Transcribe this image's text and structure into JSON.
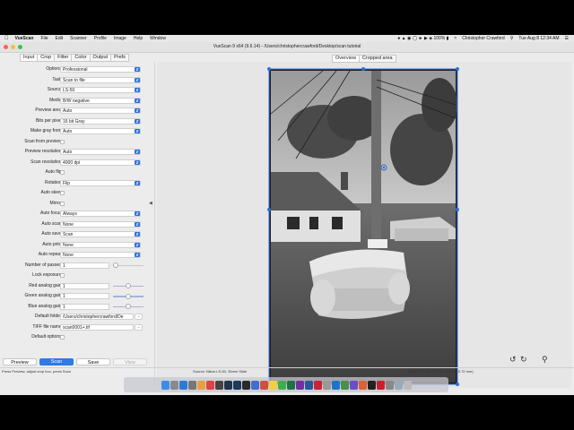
{
  "menubar": {
    "app": "VueScan",
    "items": [
      "File",
      "Edit",
      "Scanner",
      "Profile",
      "Image",
      "Help",
      "Window"
    ],
    "status_user": "Christopher Crawford",
    "clock": "Tue Aug 8  12:34 AM"
  },
  "window": {
    "title": "VueScan 9 x64 (9.6.14) - /Users/christophercrawford/Desktop/scan tutorial"
  },
  "tabs": [
    "Input",
    "Crop",
    "Filter",
    "Color",
    "Output",
    "Prefs"
  ],
  "active_tab": "Input",
  "view_tabs": [
    "Overview",
    "Cropped area"
  ],
  "form": {
    "options": {
      "label": "Options:",
      "value": "Professional"
    },
    "task": {
      "label": "Task:",
      "value": "Scan to file"
    },
    "source": {
      "label": "Source:",
      "value": "LS-50"
    },
    "media": {
      "label": "Media:",
      "value": "B/W negative"
    },
    "preview_area": {
      "label": "Preview area:",
      "value": "Auto"
    },
    "bits_per_pixel": {
      "label": "Bits per pixel:",
      "value": "16 bit Gray"
    },
    "make_gray_from": {
      "label": "Make gray from:",
      "value": "Auto"
    },
    "scan_from_preview": {
      "label": "Scan from preview:"
    },
    "preview_resolution": {
      "label": "Preview resolution:",
      "value": "Auto"
    },
    "scan_resolution": {
      "label": "Scan resolution:",
      "value": "4000 dpi"
    },
    "auto_flip": {
      "label": "Auto flip:"
    },
    "rotation": {
      "label": "Rotation:",
      "value": "Flip"
    },
    "auto_skew": {
      "label": "Auto skew:"
    },
    "mirror": {
      "label": "Mirror:"
    },
    "auto_focus": {
      "label": "Auto focus:",
      "value": "Always"
    },
    "auto_scan": {
      "label": "Auto scan:",
      "value": "None"
    },
    "auto_save": {
      "label": "Auto save:",
      "value": "Scan"
    },
    "auto_print": {
      "label": "Auto print:",
      "value": "None"
    },
    "auto_repeat": {
      "label": "Auto repeat:",
      "value": "None"
    },
    "number_of_passes": {
      "label": "Number of passes:",
      "value": "1"
    },
    "lock_exposure": {
      "label": "Lock exposure:"
    },
    "red_gain": {
      "label": "Red analog gain:",
      "value": "1"
    },
    "green_gain": {
      "label": "Green analog gain:",
      "value": "1"
    },
    "blue_gain": {
      "label": "Blue analog gain:",
      "value": "1"
    },
    "default_folder": {
      "label": "Default folder:",
      "value": "/Users/christophercrawford/De"
    },
    "tiff_file_name": {
      "label": "TIFF file name:",
      "value": "scan0001+.tif"
    },
    "default_options": {
      "label": "Default options:"
    }
  },
  "buttons": {
    "preview": "Preview",
    "scan": "Scan",
    "save": "Save",
    "view": "View"
  },
  "statusbar": {
    "left": "Press Preview, adjust crop box, press Scan",
    "center": "Source: Nikon LS-50, 35mm Slide",
    "right": "Color: 217 217 217   X: 12.35  Y: 0.72 mm)"
  },
  "colors": {
    "accent": "#2f7ae5",
    "panel": "#ececec"
  }
}
